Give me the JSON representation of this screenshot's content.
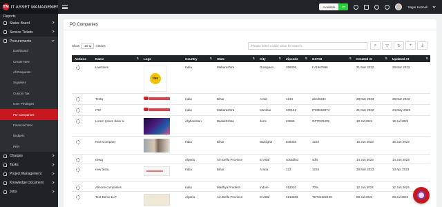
{
  "brand": {
    "logo_text": "ITM",
    "name": "IT ASSET MANAGEMENT"
  },
  "sidebar": {
    "cut_top_label": "Reports",
    "items_top": [
      {
        "label": "Status Board",
        "icon": "monitor-icon"
      },
      {
        "label": "Service Tickets",
        "icon": "ticket-icon"
      },
      {
        "label": "Procurements",
        "icon": "cart-icon"
      }
    ],
    "sub_items": [
      "Dashboard",
      "Create New",
      "All Requests",
      "Suppliers",
      "Custom Tax",
      "User Privileges",
      "PO Companies",
      "Financial Year",
      "Budgets",
      "PRR"
    ],
    "active_sub": "PO Companies",
    "items_bottom": [
      {
        "label": "Charges",
        "icon": "charge-icon"
      },
      {
        "label": "Tasks",
        "icon": "tasks-icon"
      },
      {
        "label": "Project Management",
        "icon": "project-icon"
      },
      {
        "label": "Knowledge Document",
        "icon": "book-icon"
      },
      {
        "label": "Jobs",
        "icon": "briefcase-icon"
      }
    ]
  },
  "topbar": {
    "status_label": "Available",
    "user_name": "Sagar Hotmali"
  },
  "page": {
    "title": "PO Companies",
    "show_label": "Show",
    "entries_value": "10",
    "entries_label": "entries",
    "search_placeholder": "Please enter a valid value for search"
  },
  "table": {
    "columns": [
      "Actions",
      "Name",
      "Logo",
      "Country",
      "State",
      "City",
      "Zipcode",
      "GSTIN",
      "Created At",
      "Updated At"
    ],
    "rows": [
      {
        "name": "Livetoken",
        "logo": "live",
        "country": "India",
        "state": "Maharashtra",
        "city": "Goregaon",
        "zip": "399005",
        "gstin": "LV1567996",
        "created": "21 Mar 2022",
        "updated": "28 Mar 2023"
      },
      {
        "name": "Testq",
        "logo": "itm",
        "country": "India",
        "state": "Bihar",
        "city": "Arrah",
        "zip": "1234",
        "gstin": "abcd1234",
        "created": "28 Mar 2023",
        "updated": "28 Mar 2023"
      },
      {
        "name": "ITM",
        "logo": "itm",
        "country": "India",
        "state": "Maharashtra",
        "city": "Mumbai",
        "zip": "400161",
        "gstin": "ITM9564874",
        "created": "21 Mar 2022",
        "updated": "24 May 2023"
      },
      {
        "name": "Lorem Ipsum dolor si",
        "logo": "stage",
        "country": "Afghanistan",
        "state": "Badakhshan",
        "city": "Jurm",
        "zip": "23565",
        "gstin": "GPTD03435",
        "created": "18 Jul 2024",
        "updated": "18 Jul 2024"
      },
      {
        "name": "New Company",
        "logo": "face",
        "country": "India",
        "state": "Bihar",
        "city": "Barbigha",
        "zip": "848438",
        "gstin": "1234",
        "created": "16 Jun 2023",
        "updated": "16 Jun 2023"
      },
      {
        "name": "newq",
        "logo": "",
        "country": "Algeria",
        "state": "Ain Defla Province",
        "city": "El Attaf",
        "zip": "sdsadfsd",
        "gstin": "sdfs",
        "created": "14 Jun 2023",
        "updated": "14 Jun 2023"
      },
      {
        "name": "new testq",
        "logo": "shot",
        "country": "India",
        "state": "Bihar",
        "city": "Araria",
        "zip": "123",
        "gstin": "1234",
        "created": "28 Mar 2023",
        "updated": "13 Apr 2023"
      },
      {
        "name": "Allnone companies",
        "logo": "",
        "country": "India",
        "state": "Madhya Pradesh",
        "city": "Indore",
        "zip": "452010",
        "gstin": "70%",
        "created": "12 Jun 2024",
        "updated": "12 Jun 2024"
      },
      {
        "name": "Test Demo LLP",
        "logo": "cert",
        "country": "Algeria",
        "state": "Ain Defla Province",
        "city": "El Attaf",
        "zip": "4213206",
        "gstin": "TST21622239",
        "created": "08 Jul 2024",
        "updated": "08 Jul 2024"
      }
    ]
  },
  "colors": {
    "accent": "#c7181f",
    "header_bg": "#212529",
    "sidebar_bg": "#1f2326"
  }
}
